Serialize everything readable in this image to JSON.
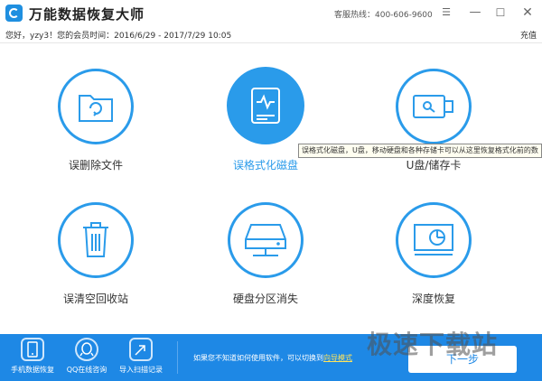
{
  "app": {
    "title": "万能数据恢复大师",
    "hotline": "客服热线：400-606-9600"
  },
  "infobar": {
    "member_info": "您好，yzy3！您的会员时间：2016/6/29 - 2017/7/29 10:05",
    "recharge": "充值"
  },
  "tiles": [
    {
      "label": "误删除文件",
      "icon": "folder-recycle-icon"
    },
    {
      "label": "误格式化磁盘",
      "icon": "hard-drive-icon"
    },
    {
      "label": "U盘/储存卡",
      "icon": "usb-drive-icon"
    },
    {
      "label": "误清空回收站",
      "icon": "trash-can-icon"
    },
    {
      "label": "硬盘分区消失",
      "icon": "disk-partition-icon"
    },
    {
      "label": "深度恢复",
      "icon": "monitor-scan-icon"
    }
  ],
  "tooltip": "误格式化磁盘，U盘，移动硬盘和各种存储卡可以从这里恢复格式化前的数",
  "bottombar": {
    "items": [
      {
        "label": "手机数据恢复",
        "icon": "phone-icon"
      },
      {
        "label": "QQ在线咨询",
        "icon": "qq-icon"
      },
      {
        "label": "导入扫描记录",
        "icon": "import-icon"
      }
    ],
    "guide_text": "如果您不知道如何使用软件，可以切换到",
    "guide_link": "向导模式",
    "next_label": "下一步"
  },
  "watermark": "极速下载站",
  "colors": {
    "accent": "#2a9bea",
    "bottom_bar": "#1e88e5"
  }
}
